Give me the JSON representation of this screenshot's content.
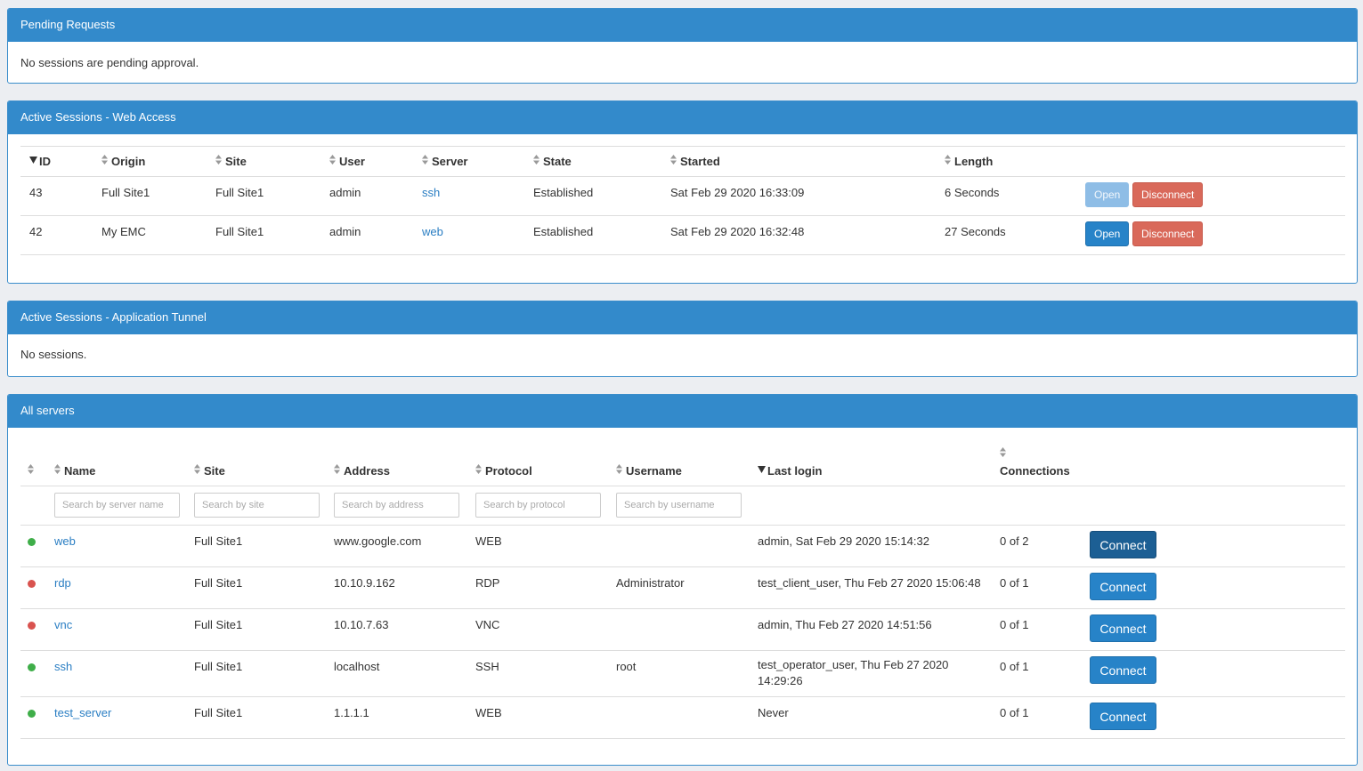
{
  "pending": {
    "title": "Pending Requests",
    "message": "No sessions are pending approval."
  },
  "web_sessions": {
    "title": "Active Sessions - Web Access",
    "columns": [
      "ID",
      "Origin",
      "Site",
      "User",
      "Server",
      "State",
      "Started",
      "Length"
    ],
    "rows": [
      {
        "id": "43",
        "origin": "Full Site1",
        "site": "Full Site1",
        "user": "admin",
        "server": "ssh",
        "state": "Established",
        "started": "Sat Feb 29 2020 16:33:09",
        "length": "6 Seconds",
        "open_label": "Open",
        "disconnect_label": "Disconnect",
        "open_disabled": true
      },
      {
        "id": "42",
        "origin": "My EMC",
        "site": "Full Site1",
        "user": "admin",
        "server": "web",
        "state": "Established",
        "started": "Sat Feb 29 2020 16:32:48",
        "length": "27 Seconds",
        "open_label": "Open",
        "disconnect_label": "Disconnect",
        "open_disabled": false
      }
    ]
  },
  "tunnel_sessions": {
    "title": "Active Sessions - Application Tunnel",
    "message": "No sessions."
  },
  "servers": {
    "title": "All servers",
    "columns": [
      "Name",
      "Site",
      "Address",
      "Protocol",
      "Username",
      "Last login",
      "Connections"
    ],
    "placeholders": {
      "name": "Search by server name",
      "site": "Search by site",
      "address": "Search by address",
      "protocol": "Search by protocol",
      "username": "Search by username"
    },
    "rows": [
      {
        "status": "online",
        "name": "web",
        "site": "Full Site1",
        "address": "www.google.com",
        "protocol": "WEB",
        "username": "",
        "last_login": "admin, Sat Feb 29 2020 15:14:32",
        "connections": "0 of 2",
        "connect_label": "Connect"
      },
      {
        "status": "offline",
        "name": "rdp",
        "site": "Full Site1",
        "address": "10.10.9.162",
        "protocol": "RDP",
        "username": "Administrator",
        "last_login": "test_client_user, Thu Feb 27 2020 15:06:48",
        "connections": "0 of 1",
        "connect_label": "Connect"
      },
      {
        "status": "offline",
        "name": "vnc",
        "site": "Full Site1",
        "address": "10.10.7.63",
        "protocol": "VNC",
        "username": "",
        "last_login": "admin, Thu Feb 27 2020 14:51:56",
        "connections": "0 of 1",
        "connect_label": "Connect"
      },
      {
        "status": "online",
        "name": "ssh",
        "site": "Full Site1",
        "address": "localhost",
        "protocol": "SSH",
        "username": "root",
        "last_login": "test_operator_user, Thu Feb 27 2020 14:29:26",
        "connections": "0 of 1",
        "connect_label": "Connect"
      },
      {
        "status": "online",
        "name": "test_server",
        "site": "Full Site1",
        "address": "1.1.1.1",
        "protocol": "WEB",
        "username": "",
        "last_login": "Never",
        "connections": "0 of 1",
        "connect_label": "Connect"
      }
    ]
  },
  "colors": {
    "header_blue": "#338acb",
    "link": "#2a7ec3",
    "status_online": "#3fae49",
    "status_offline": "#d9534f",
    "disconnect": "#d9695a"
  }
}
